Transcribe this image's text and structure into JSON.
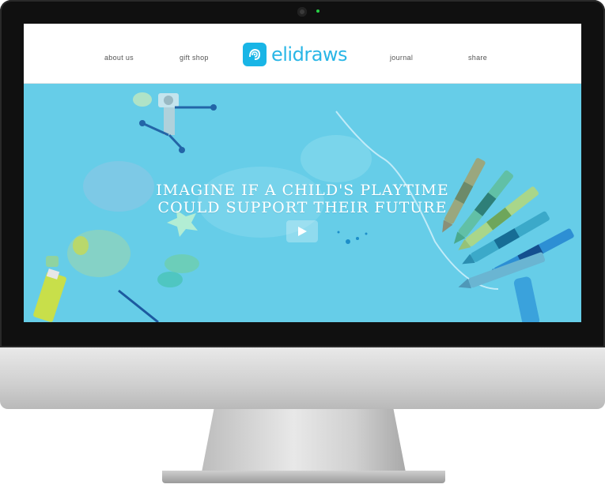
{
  "site": {
    "brand": {
      "name_part1": "eli",
      "name_part2": "draws"
    },
    "nav": {
      "about": "about us",
      "gift_shop": "gift shop",
      "journal": "journal",
      "share": "share"
    },
    "hero": {
      "headline_line1": "IMAGINE IF A CHILD'S PLAYTIME",
      "headline_line2": "COULD SUPPORT THEIR FUTURE",
      "overlay_color": "#66cde8"
    }
  },
  "colors": {
    "brand_blue": "#19b5e6",
    "hero_overlay": "#66cde8",
    "nav_text": "#555555"
  },
  "icons": {
    "play": "play-icon",
    "logo": "eli-logo-icon"
  }
}
